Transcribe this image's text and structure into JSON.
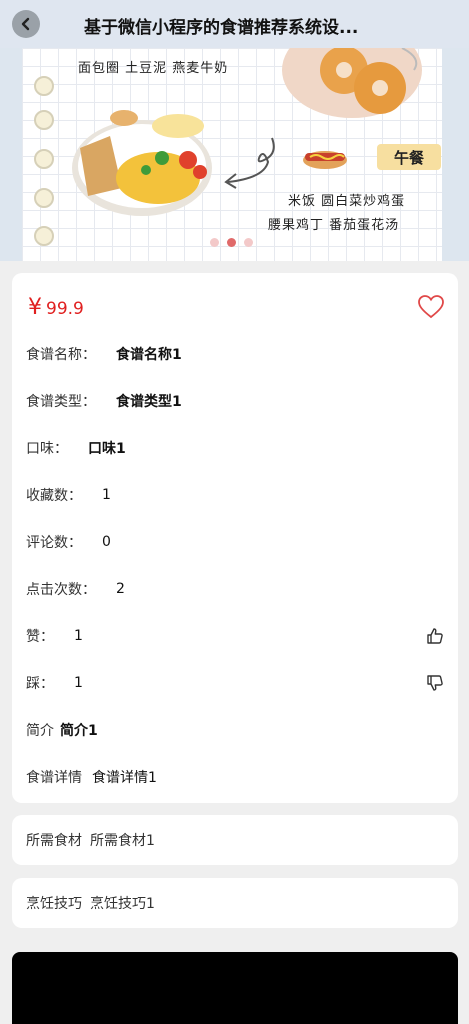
{
  "header": {
    "title": "基于微信小程序的食谱推荐系统设..."
  },
  "banner": {
    "line_top": "面包圈  土豆泥  燕麦牛奶",
    "lunch_tag": "午餐",
    "lunch_line1": "米饭  圆白菜炒鸡蛋",
    "lunch_line2": "腰果鸡丁  番茄蛋花汤"
  },
  "detail": {
    "price_symbol": "¥",
    "price_value": "99.9",
    "fields": [
      {
        "label": "食谱名称：",
        "value": "食谱名称1"
      },
      {
        "label": "食谱类型：",
        "value": "食谱类型1"
      },
      {
        "label": "口味：",
        "value": "口味1"
      },
      {
        "label": "收藏数：",
        "value": "1"
      },
      {
        "label": "评论数：",
        "value": "0"
      },
      {
        "label": "点击次数：",
        "value": "2"
      },
      {
        "label": "赞：",
        "value": "1"
      },
      {
        "label": "踩：",
        "value": "1"
      },
      {
        "label": "简介",
        "value": "简介1"
      },
      {
        "label": "食谱详情",
        "value": "食谱详情1"
      }
    ]
  },
  "ingredients": {
    "label": "所需食材",
    "value": "所需食材1"
  },
  "tips": {
    "label": "烹饪技巧",
    "value": "烹饪技巧1"
  },
  "colors": {
    "price": "#e02020",
    "header_bg": "#dfe6f0",
    "page_bg": "#efefef"
  },
  "icons": [
    "back-arrow-icon",
    "heart-icon",
    "thumbs-up-icon",
    "thumbs-down-icon"
  ]
}
